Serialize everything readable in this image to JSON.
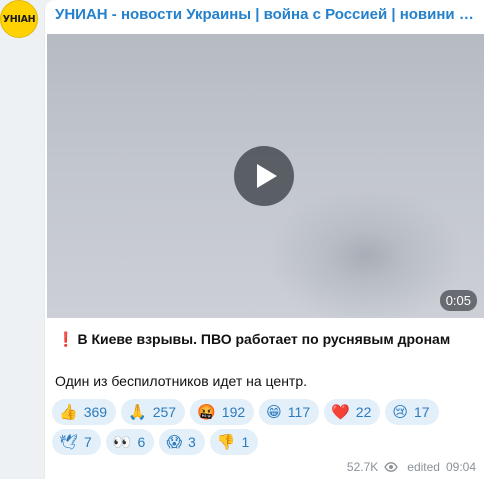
{
  "avatar": {
    "text": "УНIАН"
  },
  "channel": {
    "name": "УНИАН - новости Украины | война с Россией | новини Україні…"
  },
  "video": {
    "duration": "0:05",
    "play_icon": "play-icon"
  },
  "post": {
    "headline_emoji": "❗",
    "headline": "В Киеве взрывы. ПВО работает по руснявым дронам",
    "body": "Один из беспилотников идет на центр."
  },
  "reactions": [
    {
      "emoji": "👍",
      "count": "369"
    },
    {
      "emoji": "🙏",
      "count": "257"
    },
    {
      "emoji": "🤬",
      "count": "192"
    },
    {
      "emoji": "😁",
      "count": "117"
    },
    {
      "emoji": "❤️",
      "count": "22"
    },
    {
      "emoji": "😢",
      "count": "17"
    },
    {
      "emoji": "🕊",
      "count": "7"
    },
    {
      "emoji": "👀",
      "count": "6"
    },
    {
      "emoji": "😱",
      "count": "3"
    },
    {
      "emoji": "👎",
      "count": "1"
    }
  ],
  "meta": {
    "views": "52.7K",
    "views_icon": "eye-icon",
    "edited": "edited",
    "time": "09:04"
  },
  "colors": {
    "accent": "#2481cc",
    "reaction_bg": "#e3eff9",
    "avatar_bg": "#ffd200"
  }
}
